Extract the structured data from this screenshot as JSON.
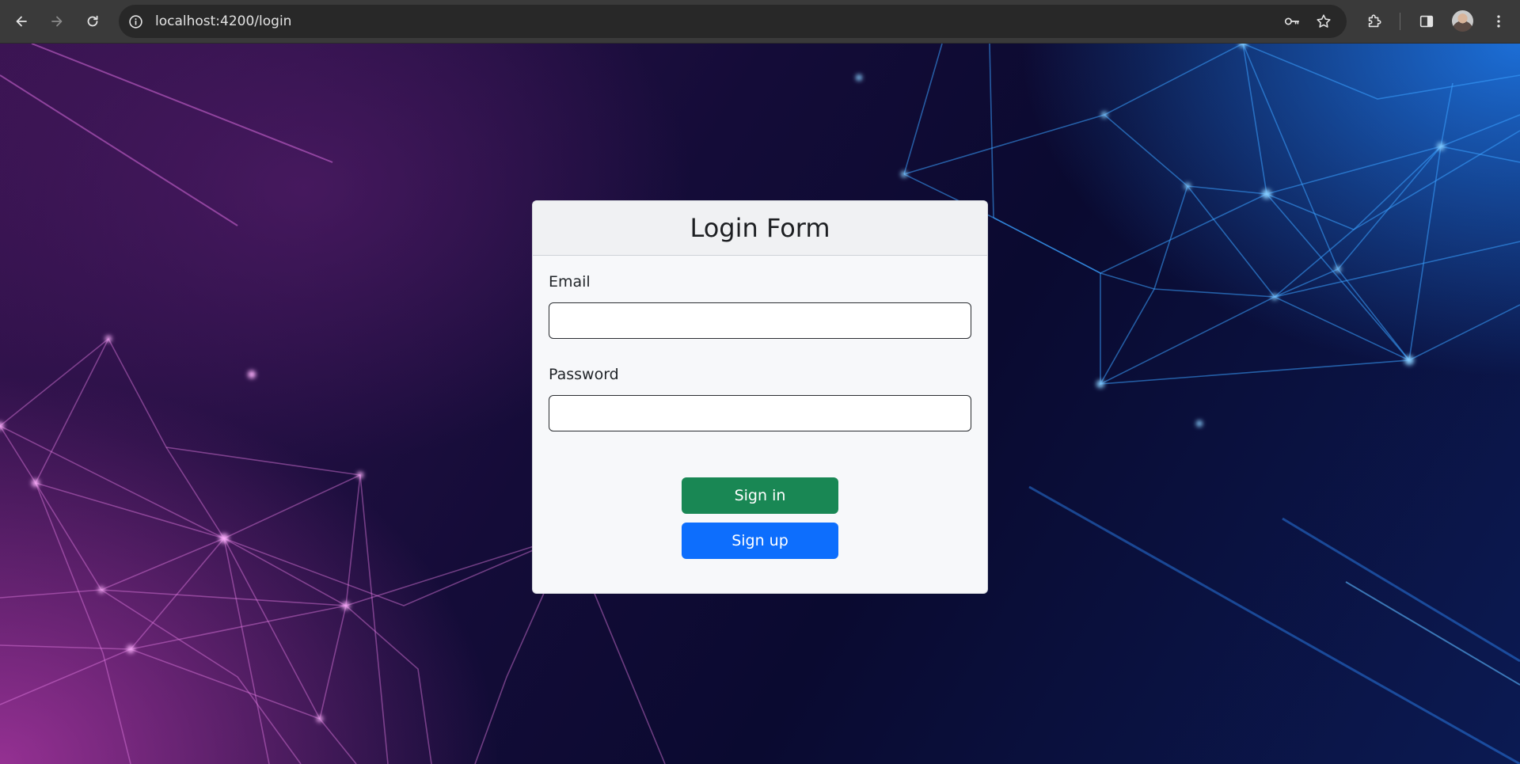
{
  "browser": {
    "url": "localhost:4200/login",
    "icons": {
      "back": "arrow-left-icon",
      "forward": "arrow-right-icon",
      "reload": "reload-icon",
      "site_info": "info-icon",
      "password_key": "key-icon",
      "bookmark": "star-icon",
      "extensions": "puzzle-icon",
      "side_panel": "side-panel-icon",
      "profile": "avatar",
      "menu": "kebab-menu-icon"
    }
  },
  "login": {
    "title": "Login Form",
    "email_label": "Email",
    "email_value": "",
    "password_label": "Password",
    "password_value": "",
    "signin_label": "Sign in",
    "signup_label": "Sign up"
  },
  "colors": {
    "signin": "#198754",
    "signup": "#0d6efd",
    "card_bg": "#f7f8fa",
    "header_bg": "#f0f1f3"
  }
}
